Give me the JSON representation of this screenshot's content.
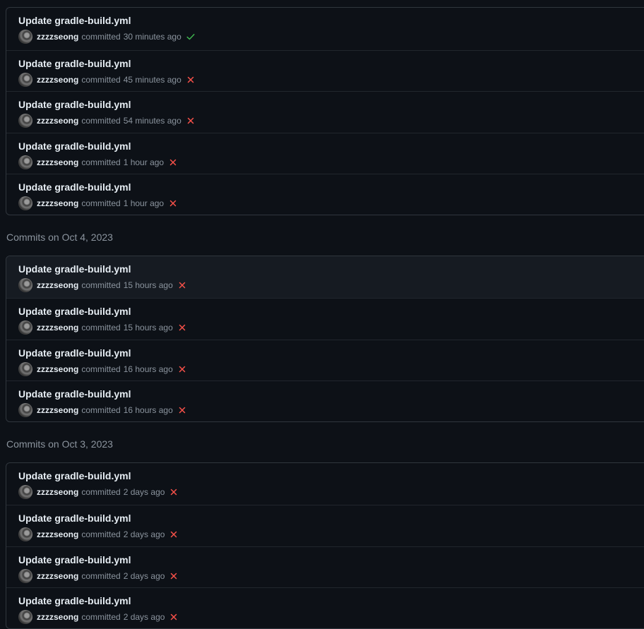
{
  "colors": {
    "background": "#0d1117",
    "border": "#30363d",
    "text": "#e6edf3",
    "muted": "#8b949e",
    "success": "#3fb950",
    "failure": "#f85149"
  },
  "groups": [
    {
      "header": "",
      "commits": [
        {
          "title": "Update gradle-build.yml",
          "author": "zzzzseong",
          "verb": "committed",
          "time": "30 minutes ago",
          "status": "success"
        },
        {
          "title": "Update gradle-build.yml",
          "author": "zzzzseong",
          "verb": "committed",
          "time": "45 minutes ago",
          "status": "failure"
        },
        {
          "title": "Update gradle-build.yml",
          "author": "zzzzseong",
          "verb": "committed",
          "time": "54 minutes ago",
          "status": "failure"
        },
        {
          "title": "Update gradle-build.yml",
          "author": "zzzzseong",
          "verb": "committed",
          "time": "1 hour ago",
          "status": "failure"
        },
        {
          "title": "Update gradle-build.yml",
          "author": "zzzzseong",
          "verb": "committed",
          "time": "1 hour ago",
          "status": "failure"
        }
      ]
    },
    {
      "header": "Commits on Oct 4, 2023",
      "commits": [
        {
          "title": "Update gradle-build.yml",
          "author": "zzzzseong",
          "verb": "committed",
          "time": "15 hours ago",
          "status": "failure"
        },
        {
          "title": "Update gradle-build.yml",
          "author": "zzzzseong",
          "verb": "committed",
          "time": "15 hours ago",
          "status": "failure"
        },
        {
          "title": "Update gradle-build.yml",
          "author": "zzzzseong",
          "verb": "committed",
          "time": "16 hours ago",
          "status": "failure"
        },
        {
          "title": "Update gradle-build.yml",
          "author": "zzzzseong",
          "verb": "committed",
          "time": "16 hours ago",
          "status": "failure"
        }
      ]
    },
    {
      "header": "Commits on Oct 3, 2023",
      "commits": [
        {
          "title": "Update gradle-build.yml",
          "author": "zzzzseong",
          "verb": "committed",
          "time": "2 days ago",
          "status": "failure"
        },
        {
          "title": "Update gradle-build.yml",
          "author": "zzzzseong",
          "verb": "committed",
          "time": "2 days ago",
          "status": "failure"
        },
        {
          "title": "Update gradle-build.yml",
          "author": "zzzzseong",
          "verb": "committed",
          "time": "2 days ago",
          "status": "failure"
        },
        {
          "title": "Update gradle-build.yml",
          "author": "zzzzseong",
          "verb": "committed",
          "time": "2 days ago",
          "status": "failure"
        }
      ]
    }
  ]
}
